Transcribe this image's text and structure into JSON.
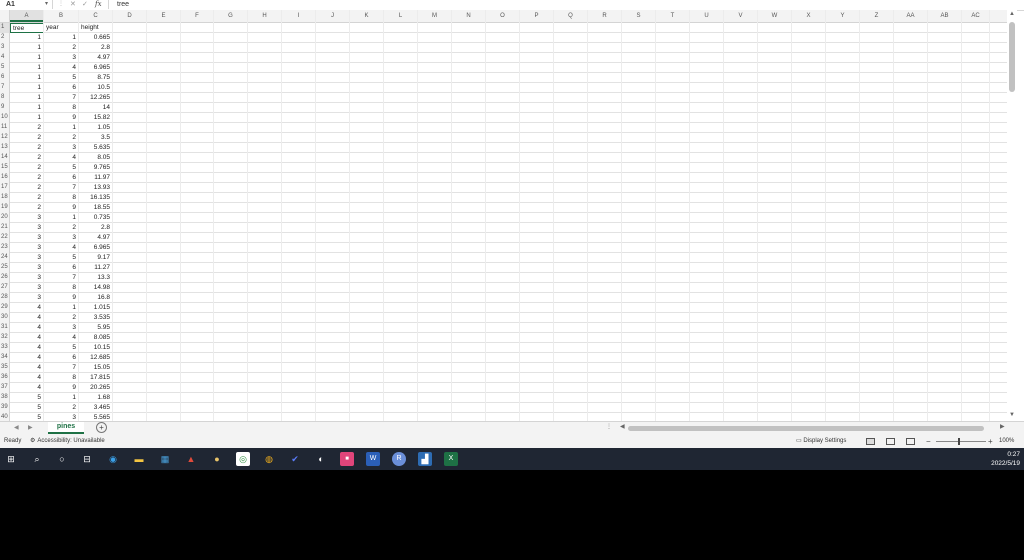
{
  "formula_bar": {
    "name_box": "A1",
    "formula": "tree",
    "fx_label": "fx"
  },
  "columns": [
    "A",
    "B",
    "C",
    "D",
    "E",
    "F",
    "G",
    "H",
    "I",
    "J",
    "K",
    "L",
    "M",
    "N",
    "O",
    "P",
    "Q",
    "R",
    "S",
    "T",
    "U",
    "V",
    "W",
    "X",
    "Y",
    "Z",
    "AA",
    "AB",
    "AC"
  ],
  "header_row": [
    "tree",
    "year",
    "height"
  ],
  "data_rows": [
    [
      "1",
      "1",
      "0.665"
    ],
    [
      "1",
      "2",
      "2.8"
    ],
    [
      "1",
      "3",
      "4.97"
    ],
    [
      "1",
      "4",
      "6.965"
    ],
    [
      "1",
      "5",
      "8.75"
    ],
    [
      "1",
      "6",
      "10.5"
    ],
    [
      "1",
      "7",
      "12.265"
    ],
    [
      "1",
      "8",
      "14"
    ],
    [
      "1",
      "9",
      "15.82"
    ],
    [
      "2",
      "1",
      "1.05"
    ],
    [
      "2",
      "2",
      "3.5"
    ],
    [
      "2",
      "3",
      "5.635"
    ],
    [
      "2",
      "4",
      "8.05"
    ],
    [
      "2",
      "5",
      "9.765"
    ],
    [
      "2",
      "6",
      "11.97"
    ],
    [
      "2",
      "7",
      "13.93"
    ],
    [
      "2",
      "8",
      "16.135"
    ],
    [
      "2",
      "9",
      "18.55"
    ],
    [
      "3",
      "1",
      "0.735"
    ],
    [
      "3",
      "2",
      "2.8"
    ],
    [
      "3",
      "3",
      "4.97"
    ],
    [
      "3",
      "4",
      "6.965"
    ],
    [
      "3",
      "5",
      "9.17"
    ],
    [
      "3",
      "6",
      "11.27"
    ],
    [
      "3",
      "7",
      "13.3"
    ],
    [
      "3",
      "8",
      "14.98"
    ],
    [
      "3",
      "9",
      "16.8"
    ],
    [
      "4",
      "1",
      "1.015"
    ],
    [
      "4",
      "2",
      "3.535"
    ],
    [
      "4",
      "3",
      "5.95"
    ],
    [
      "4",
      "4",
      "8.085"
    ],
    [
      "4",
      "5",
      "10.15"
    ],
    [
      "4",
      "6",
      "12.685"
    ],
    [
      "4",
      "7",
      "15.05"
    ],
    [
      "4",
      "8",
      "17.815"
    ],
    [
      "4",
      "9",
      "20.265"
    ],
    [
      "5",
      "1",
      "1.68"
    ],
    [
      "5",
      "2",
      "3.465"
    ],
    [
      "5",
      "3",
      "5.565"
    ]
  ],
  "row_numbers": [
    "1",
    "2",
    "3",
    "4",
    "5",
    "6",
    "7",
    "8",
    "9",
    "10",
    "11",
    "12",
    "13",
    "14",
    "15",
    "16",
    "17",
    "18",
    "19",
    "20",
    "21",
    "22",
    "23",
    "24",
    "25",
    "26",
    "27",
    "28",
    "29",
    "30",
    "31",
    "32",
    "33",
    "34",
    "35",
    "36",
    "37",
    "38",
    "39",
    "40"
  ],
  "sheet_tab": "pines",
  "status": {
    "ready": "Ready",
    "accessibility": "Accessibility: Unavailable",
    "display_settings": "Display Settings",
    "zoom": "100%"
  },
  "clock": {
    "time": "0:27",
    "date": "2022/5/19"
  },
  "colors": {
    "excel_green": "#1e7145",
    "taskbar": "#1f2633"
  }
}
